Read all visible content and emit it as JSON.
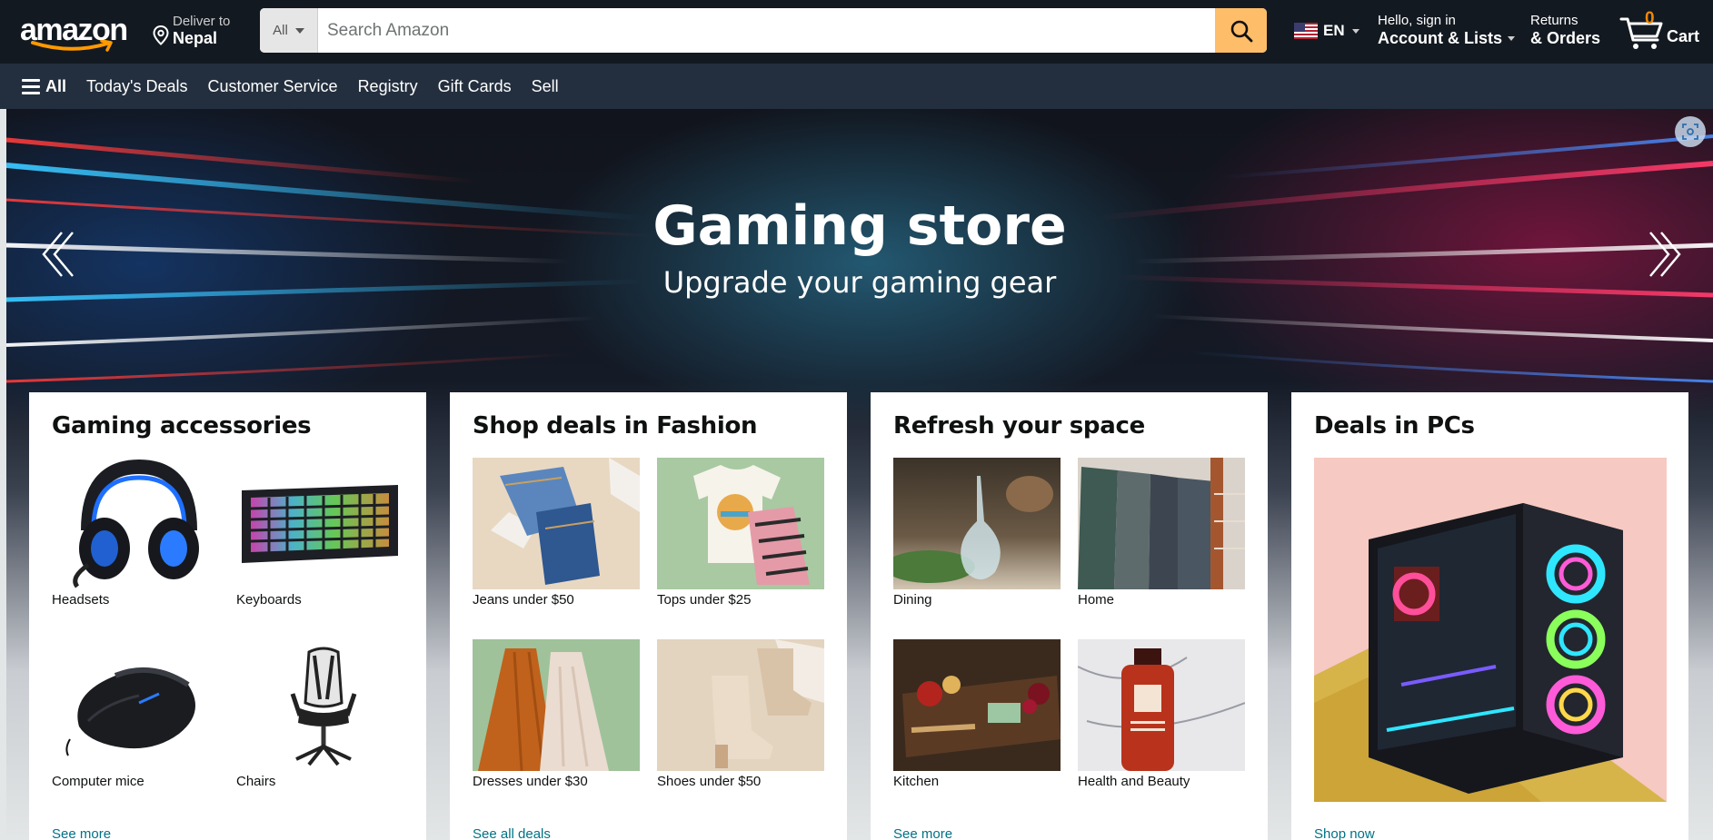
{
  "header": {
    "logo": "amazon",
    "deliver_line1": "Deliver to",
    "deliver_line2": "Nepal",
    "search_category": "All",
    "search_placeholder": "Search Amazon",
    "language": "EN",
    "account_line1": "Hello, sign in",
    "account_line2": "Account & Lists",
    "returns_line1": "Returns",
    "returns_line2": "& Orders",
    "cart_count": "0",
    "cart_label": "Cart"
  },
  "subnav": {
    "all_label": "All",
    "items": [
      "Today's Deals",
      "Customer Service",
      "Registry",
      "Gift Cards",
      "Sell"
    ]
  },
  "hero": {
    "title": "Gaming store",
    "subtitle": "Upgrade your gaming gear"
  },
  "cards": [
    {
      "title": "Gaming accessories",
      "items": [
        "Headsets",
        "Keyboards",
        "Computer mice",
        "Chairs"
      ],
      "link": "See more"
    },
    {
      "title": "Shop deals in Fashion",
      "items": [
        "Jeans under $50",
        "Tops under $25",
        "Dresses under $30",
        "Shoes under $50"
      ],
      "link": "See all deals"
    },
    {
      "title": "Refresh your space",
      "items": [
        "Dining",
        "Home",
        "Kitchen",
        "Health and Beauty"
      ],
      "link": "See more"
    },
    {
      "title": "Deals in PCs",
      "link": "Shop now"
    }
  ],
  "colors": {
    "nav_top": "#131921",
    "nav_sub": "#232f3e",
    "search_button": "#febd69",
    "cart_count": "#f08804",
    "link": "#007185"
  },
  "icons": [
    "location-pin-icon",
    "search-icon",
    "us-flag-icon",
    "cart-icon",
    "hamburger-icon",
    "chevron-left-icon",
    "chevron-right-icon",
    "lens-icon"
  ]
}
